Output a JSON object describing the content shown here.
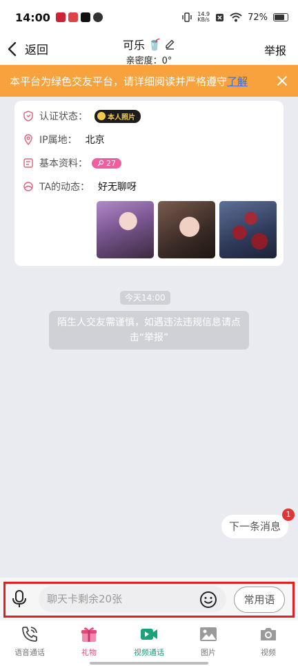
{
  "status_bar": {
    "time": "14:00",
    "speed_top": "14.9",
    "speed_bottom": "KB/s",
    "battery": "72%"
  },
  "header": {
    "back_label": "返回",
    "title": "可乐",
    "title_emoji": "🥤",
    "intimacy": "亲密度：0°",
    "report_label": "举报"
  },
  "notice": {
    "text": "本平台为绿色交友平台，请详细阅读并严格遵守",
    "link": "了解"
  },
  "profile": {
    "auth_label": "认证状态：",
    "auth_badge": "本人照片",
    "ip_label": "IP属地：",
    "ip_value": "北京",
    "basic_label": "基本资料：",
    "age": "27",
    "moments_label": "TA的动态：",
    "moments_value": "好无聊呀"
  },
  "chat": {
    "time": "今天14:00",
    "system_message": "陌生人交友需谨慎，如遇违法违规信息请点击“举报”",
    "next_message": "下一条消息",
    "next_badge": "1"
  },
  "input": {
    "placeholder": "聊天卡剩余20张",
    "phrases_label": "常用语"
  },
  "bottom_nav": [
    {
      "label": "语音通话",
      "icon": "phone-icon",
      "color": "#777777"
    },
    {
      "label": "礼物",
      "icon": "gift-icon",
      "color": "#e0487a"
    },
    {
      "label": "视频通话",
      "icon": "video-icon",
      "color": "#1aa27a"
    },
    {
      "label": "图片",
      "icon": "image-icon",
      "color": "#777777"
    },
    {
      "label": "视频",
      "icon": "camera-icon",
      "color": "#777777"
    }
  ],
  "colors": {
    "notice_bg": "#f7a23c",
    "gift": "#e0487a",
    "video": "#1aa27a",
    "age_badge": "#ef5fa0",
    "highlight": "#e02020"
  }
}
